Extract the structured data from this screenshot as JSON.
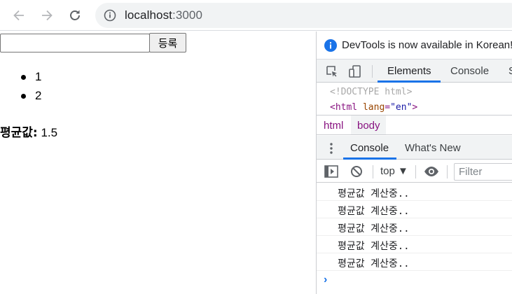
{
  "browser": {
    "url_host": "localhost",
    "url_port": ":3000",
    "icons": {
      "back": "arrow-left-icon",
      "forward": "arrow-right-icon",
      "reload": "reload-icon",
      "site_info": "info-icon"
    }
  },
  "page": {
    "input_value": "",
    "submit_label": "등록",
    "list_items": [
      "1",
      "2"
    ],
    "average_label": "평균값:",
    "average_value": "1.5"
  },
  "devtools": {
    "notice_text": "DevTools is now available in Korean!",
    "tabs": [
      "Elements",
      "Console",
      "S"
    ],
    "active_tab": "Elements",
    "elements_lines": {
      "doctype": "<!DOCTYPE html>",
      "html_open": "<html",
      "html_attr": "lang",
      "html_eq": "=",
      "html_val": "\"en\"",
      "html_close": ">"
    },
    "breadcrumbs": [
      "html",
      "body"
    ],
    "drawer_tabs": [
      "Console",
      "What's New"
    ],
    "active_drawer_tab": "Console",
    "context": "top ▼",
    "filter_placeholder": "Filter",
    "logs": [
      "평균값 계산중..",
      "평균값 계산중..",
      "평균값 계산중..",
      "평균값 계산중..",
      "평균값 계산중.."
    ],
    "prompt_symbol": "›"
  },
  "colors": {
    "accent": "#1a73e8",
    "tag": "#881280",
    "attr": "#994500",
    "attr_value": "#1a1aa6"
  }
}
